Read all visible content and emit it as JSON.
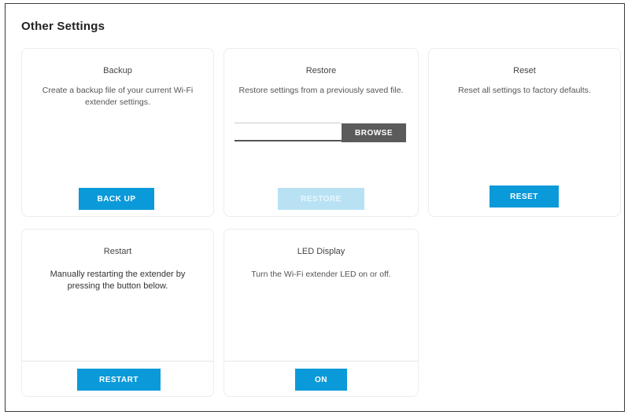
{
  "page": {
    "title": "Other Settings"
  },
  "cards": {
    "backup": {
      "title": "Backup",
      "description": "Create a backup file of your current Wi-Fi extender settings.",
      "button": "BACK UP"
    },
    "restore": {
      "title": "Restore",
      "description": "Restore settings from a previously saved file.",
      "file_placeholder": "",
      "browse": "BROWSE",
      "button": "RESTORE"
    },
    "reset": {
      "title": "Reset",
      "description": "Reset all settings to factory defaults.",
      "button": "RESET"
    },
    "restart": {
      "title": "Restart",
      "description": "Manually restarting the extender by pressing the button below.",
      "button": "RESTART"
    },
    "led": {
      "title": "LED Display",
      "description": "Turn the Wi-Fi extender LED on or off.",
      "button": "ON"
    }
  },
  "colors": {
    "primary": "#0b9ad9",
    "disabled": "#b8e2f4",
    "browse": "#5b5b5b",
    "frame_border": "#3a3a3a"
  }
}
